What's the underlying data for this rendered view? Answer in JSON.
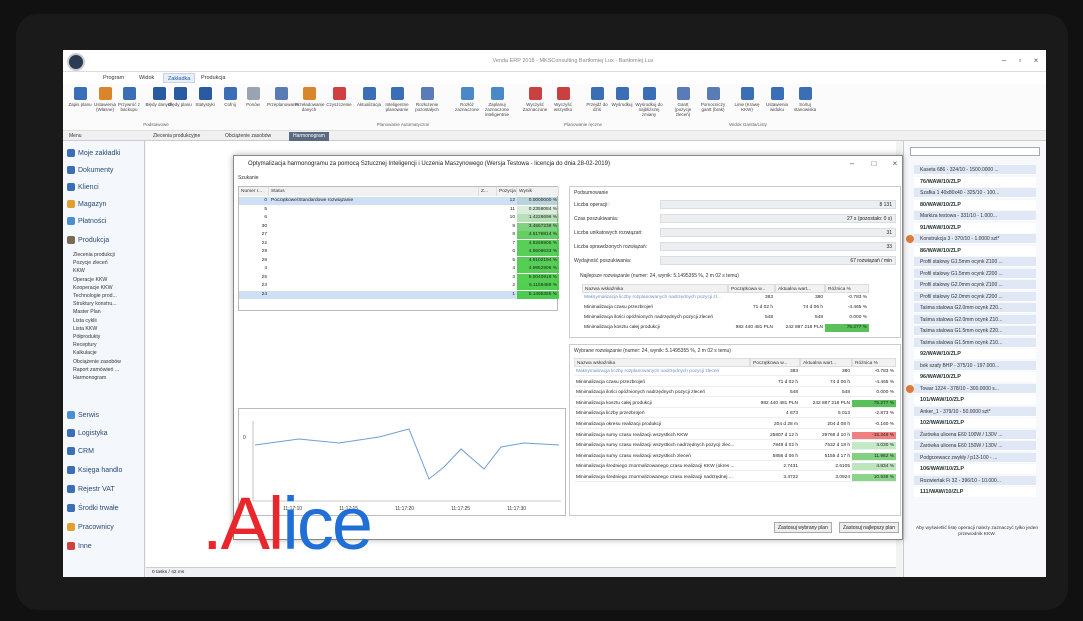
{
  "window": {
    "title": "Venda ERP 2018 - MKSConsulting Bartłomiej Lux - Bartłomiej Lux"
  },
  "menu": [
    "Program",
    "Widok",
    "Zakładka",
    "Produkcja"
  ],
  "ribbon": {
    "buttons": [
      "Zapis planu",
      "Ustawienia (Własne)",
      "Przywróć z backupu",
      "Błędy danych",
      "Błędy planu",
      "Statystyki",
      "Cofnij",
      "Ponów",
      "Przeplanowanie",
      "Przeładowanie danych",
      "Czyszczenie",
      "Aktualizacja",
      "Inteligentne planowanie",
      "Rozłożenie pozostałych",
      "Rozłóż zaznaczone",
      "Zaplanuj zaznaczone inteligentnie",
      "Wyczyść Zaznaczone",
      "Wyczyść wszystko",
      "Przejdź do dziś",
      "Wyśrodkuj",
      "Wyśrodkuj do najbliższej zmiany",
      "Gantt (pozycje zleceń)",
      "Pomocniczy gantt (brak)",
      "Linie (Krawę KKW)",
      "Ustawienia widoku",
      "Sortuj stanowiska"
    ],
    "groups": [
      "Podstawowe",
      "Planowanie Automatyczne",
      "Planowanie ręczne",
      "Widok Gantta/Listy"
    ]
  },
  "tabs": [
    "Menu",
    "Zlecenia produkcyjne",
    "Obciążenie zasobów",
    "Harmonogram"
  ],
  "sidebar": {
    "items": [
      "Moje zakładki",
      "Dokumenty",
      "Klienci",
      "Magazyn",
      "Płatności",
      "Produkcja",
      "Serwis",
      "Logistyka",
      "CRM",
      "Księga handlo",
      "Rejestr VAT",
      "Środki trwałe",
      "Pracownicy",
      "Inne"
    ],
    "sub": [
      "Zlecenia produkcji",
      "Pozycje zleceń",
      "KKW",
      "Operacje KKW",
      "Kooperacje KKW",
      "Technologie prod...",
      "Struktury konstru...",
      "Master Plan",
      "Lista cyklii",
      "Lista KKW",
      "Półprodukty",
      "Receptury",
      "Kalkulacje",
      "Obciążenie zasobów",
      "Raport zamówień ...",
      "Harmonogram"
    ]
  },
  "dialog": {
    "title": "Optymalizacja harmonogramu za pomocą Sztucznej Inteligencji i Uczenia Maszynowego (Wersja Testowa - licencja do dnia 28-02-2019)",
    "search": "Szukanie",
    "list_headers": [
      "Numer r...",
      "Status",
      "Z...",
      "Pozycja",
      "Wynik"
    ],
    "rows": [
      [
        "0",
        "Początkowe/Standardowe rozwiązanie",
        "",
        "12",
        "0.0000000 %"
      ],
      [
        "5",
        "",
        "",
        "11",
        "0.2358084 %"
      ],
      [
        "6",
        "",
        "",
        "10",
        "1.4228696 %"
      ],
      [
        "30",
        "",
        "",
        "9",
        "3.4567238 %"
      ],
      [
        "27",
        "",
        "",
        "8",
        "4.5178814 %"
      ],
      [
        "22",
        "",
        "",
        "7",
        "4.8266905 %"
      ],
      [
        "29",
        "",
        "",
        "6",
        "4.8608633 %"
      ],
      [
        "28",
        "",
        "",
        "5",
        "4.9102194 %"
      ],
      [
        "4",
        "",
        "",
        "4",
        "4.9852906 %"
      ],
      [
        "25",
        "",
        "",
        "3",
        "5.0040918 %"
      ],
      [
        "23",
        "",
        "",
        "2",
        "5.1159489 %"
      ],
      [
        "24",
        "",
        "",
        "1",
        "5.1495355 %"
      ]
    ],
    "chart_xlabels": [
      "11:17:10",
      "11:17:15",
      "11:17:20",
      "11:17:25",
      "11:17:30"
    ],
    "chart_y0": "0",
    "summary": {
      "title": "Podsumowanie",
      "labels": [
        "Liczba operacji:",
        "Czas poszukiwania:",
        "Liczba unikatowych rozwiązań:",
        "Liczba sprawdzonych rozwiązań:",
        "Wydajność poszukiwania:"
      ],
      "values": [
        "8 131",
        "27 s (pozostało: 0 s)",
        "31",
        "33",
        "67 rozwiązań / min"
      ]
    },
    "best_title": "Najlepsze rozwiązanie (numer: 24, wynik: 5.1495355 %, 2 m 02 s temu)",
    "best_headers": [
      "Nazwa wskaźnika",
      "Początkowa w...",
      "Aktualna wart...",
      "Różnica %"
    ],
    "best_rows": [
      [
        "Maksymalizacja liczby rozplanowanych nadrzędnych pozycji zl...",
        "383",
        "380",
        "-0.783 %"
      ],
      [
        "Minimalizacja czasu przezbrojeń",
        "71 d 02 h",
        "74 d 06 h",
        "-4.465 %"
      ],
      [
        "Minimalizacja ilości opóźnionych nadrzędnych pozycji zleceń",
        "548",
        "548",
        "0.000 %"
      ],
      [
        "Minimalizacja kosztu całej produkcji",
        "982 440 481 PLN",
        "242 887 218 PLN",
        "75.277 %"
      ]
    ],
    "sel_title": "Wybrane rozwiązanie (numer: 24, wynik: 5.1495355 %, 2 m 02 s temu)",
    "sel_rows": [
      [
        "Maksymalizacja liczby rozplanowanych nadrzędnych pozycji zleceń",
        "383",
        "380",
        "-0.783 %"
      ],
      [
        "Minimalizacja czasu przezbrojeń",
        "71 d 02 h",
        "74 d 06 h",
        "-4.465 %"
      ],
      [
        "Minimalizacja ilości opóźnionych nadrzędnych pozycji zleceń",
        "548",
        "548",
        "0.000 %"
      ],
      [
        "Minimalizacja kosztu całej produkcji",
        "982 440 481 PLN",
        "242 887 218 PLN",
        "75.277 %"
      ],
      [
        "Minimalizacja liczby przezbrojeń",
        "4 873",
        "5 013",
        "-2.873 %"
      ],
      [
        "Minimalizacja okresu realizacji produkcji",
        "204 d 28 m",
        "204 d 08 h",
        "-0.160 %"
      ],
      [
        "Minimalizacja sumy czasu realizacji wszystkich KKW",
        "25807 d 12 h",
        "29768 d 10 h",
        "-15.348 %"
      ],
      [
        "Minimalizacja sumy czasu realizacji wszystkich nadrzędnych pozycji zlec...",
        "7849 d 02 h",
        "7532 d 18 h",
        "4.030 %"
      ],
      [
        "Minimalizacja sumy czasu realizacji wszystkich zleceń",
        "5856 d 06 h",
        "5155 d 17 h",
        "11.962 %"
      ],
      [
        "Minimalizacja średniego znormalizowanego czasu realizacji KKW (okres ...",
        "2.7431",
        "2.6105",
        "4.834 %"
      ],
      [
        "Minimalizacja średniego znormalizowanego czasu realizacji nadrzędnej ...",
        "3.4722",
        "3.0924",
        "10.938 %"
      ]
    ],
    "btn_apply_selected": "Zastosuj wybrany plan",
    "btn_apply_best": "Zastosuj najlepszy plan"
  },
  "right_panel": [
    [
      "Kaseta 686 - 324/10 - 1500.0000 ...",
      ""
    ],
    [
      "76/WAW/10/ZLP",
      "bold"
    ],
    [
      "Szafka 1 40x80x40 - 325/10 - 100...",
      ""
    ],
    [
      "80/WAW/10/ZLP",
      "bold"
    ],
    [
      "Markiza testowa - 331/10 - 1.000...",
      ""
    ],
    [
      "91/WAW/10/ZLP",
      "bold"
    ],
    [
      "Konstrukcja 3 - 370/10 - 1.0000 szt*",
      "warn"
    ],
    [
      "86/WAW/10/ZLP",
      "bold"
    ],
    [
      "Profil stalowy G1.5mm ocynk Z100 ...",
      ""
    ],
    [
      "Profil stalowy G1.5mm ocynk Z200 ...",
      ""
    ],
    [
      "Profil stalowy G2.0mm ocynk Z100 ...",
      ""
    ],
    [
      "Profil stalowy G2.0mm ocynk Z200 ...",
      ""
    ],
    [
      "Taśma stalowa G2.0mm ocynk Z20...",
      ""
    ],
    [
      "Taśma stalowa G2.0mm ocynk Z10...",
      ""
    ],
    [
      "Taśma stalowa G1.5mm ocynk Z20...",
      ""
    ],
    [
      "Taśma stalowa G1.5mm ocynk Z10...",
      ""
    ],
    [
      "92/WAW/10/ZLP",
      "bold"
    ],
    [
      "bok szafy BHP - 375/10 - 197.000...",
      ""
    ],
    [
      "96/WAW/10/ZLP",
      "bold"
    ],
    [
      "Towar 1224 - 378/10 - 300.0000 s...",
      "warn"
    ],
    [
      "101/WAW/10/ZLP",
      "bold"
    ],
    [
      "Anker_1 - 379/10 - 50.0000 szt*",
      ""
    ],
    [
      "102/WAW/10/ZLP",
      "bold"
    ],
    [
      "Żarówka ulicena E60 100W / 130V ...",
      ""
    ],
    [
      "Żarówka ulicena E60 150W / 130V ...",
      ""
    ],
    [
      "Podgrzewacz zwykły / p13-100 - ...",
      ""
    ],
    [
      "106/WAW/10/ZLP",
      "bold"
    ],
    [
      "Rozwiertak Fi 32 - 396/10 - 10.000...",
      ""
    ],
    [
      "111/WAW/10/ZLP",
      "bold"
    ]
  ],
  "right_note": "Aby wyświetlić listę operacji należy zaznaczyć tylko jeden przewodnik KKW.",
  "statusbar": "0 tasks / 42 ms",
  "watermark": {
    "dot": ".",
    "A": "A",
    "l": "l",
    "ice": "ice",
    "color_red": "#e8262c",
    "color_blue": "#1f6fd6"
  }
}
